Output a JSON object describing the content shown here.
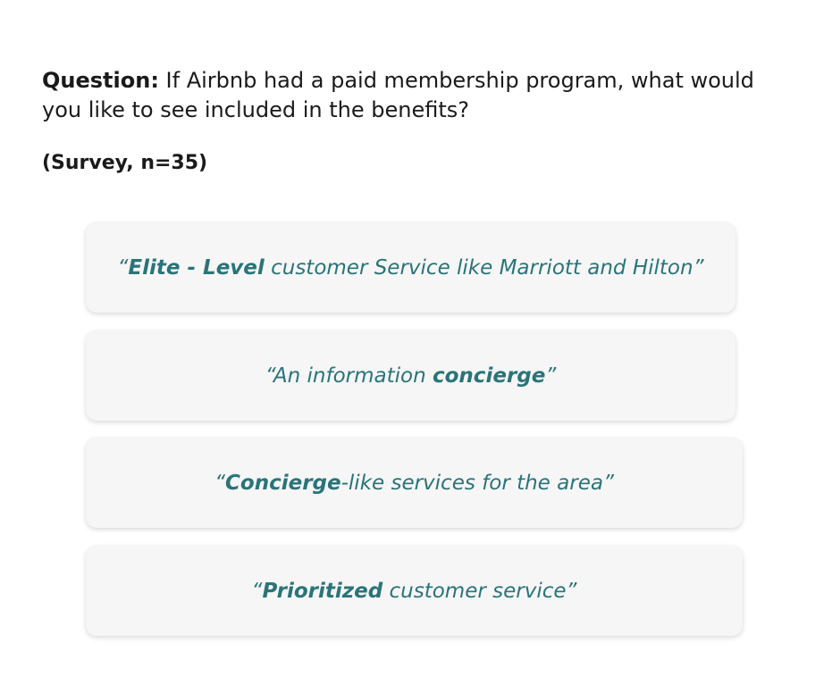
{
  "question": {
    "label": "Question:",
    "text": " If Airbnb had a paid membership program, what would you like to see included in the benefits?"
  },
  "survey_meta": "(Survey, n=35)",
  "quotes": [
    {
      "open": "“",
      "bold": "Elite - Level",
      "rest": " customer Service like Marriott and Hilton",
      "close": "”"
    },
    {
      "open": "“An information ",
      "bold": "concierge",
      "close": "”"
    },
    {
      "open": "“",
      "bold": "Concierge",
      "rest": "-like services for the area",
      "close": "”"
    },
    {
      "open": "“",
      "bold": "Prioritized",
      "rest": " customer service",
      "close": "”"
    }
  ],
  "colors": {
    "quote_text": "#2a7479",
    "card_background": "#f6f6f6",
    "body_text": "#1a1a1a"
  }
}
